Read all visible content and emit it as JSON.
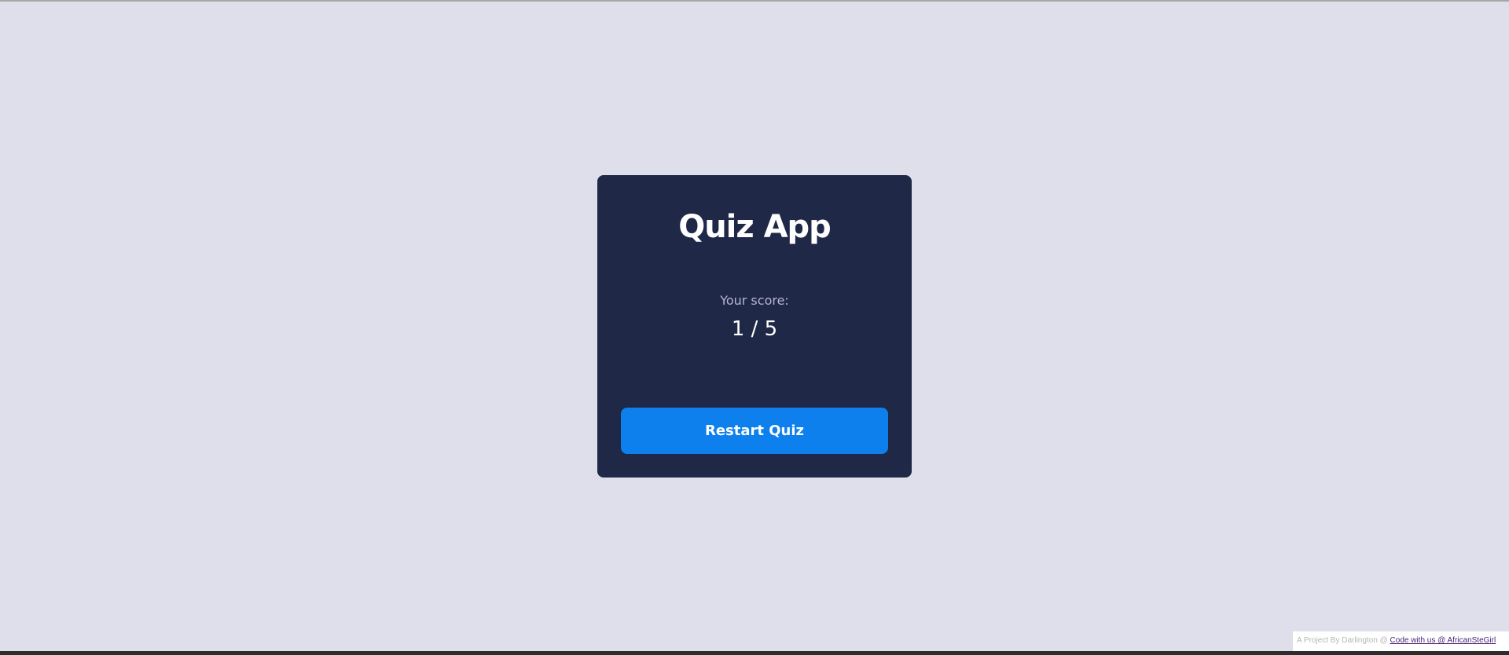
{
  "app": {
    "title": "Quiz App"
  },
  "result": {
    "score_label": "Your score:",
    "score_value": "1 / 5"
  },
  "actions": {
    "restart_label": "Restart Quiz"
  },
  "footer": {
    "text": "A Project By Darlington @ ",
    "link_label": "Code with us @ AfricanSteGirl"
  },
  "colors": {
    "page_background": "#dedfea",
    "card_background": "#1f2847",
    "button_background": "#0d80ee",
    "score_label": "#b4b6d1",
    "link": "#4a2573"
  }
}
